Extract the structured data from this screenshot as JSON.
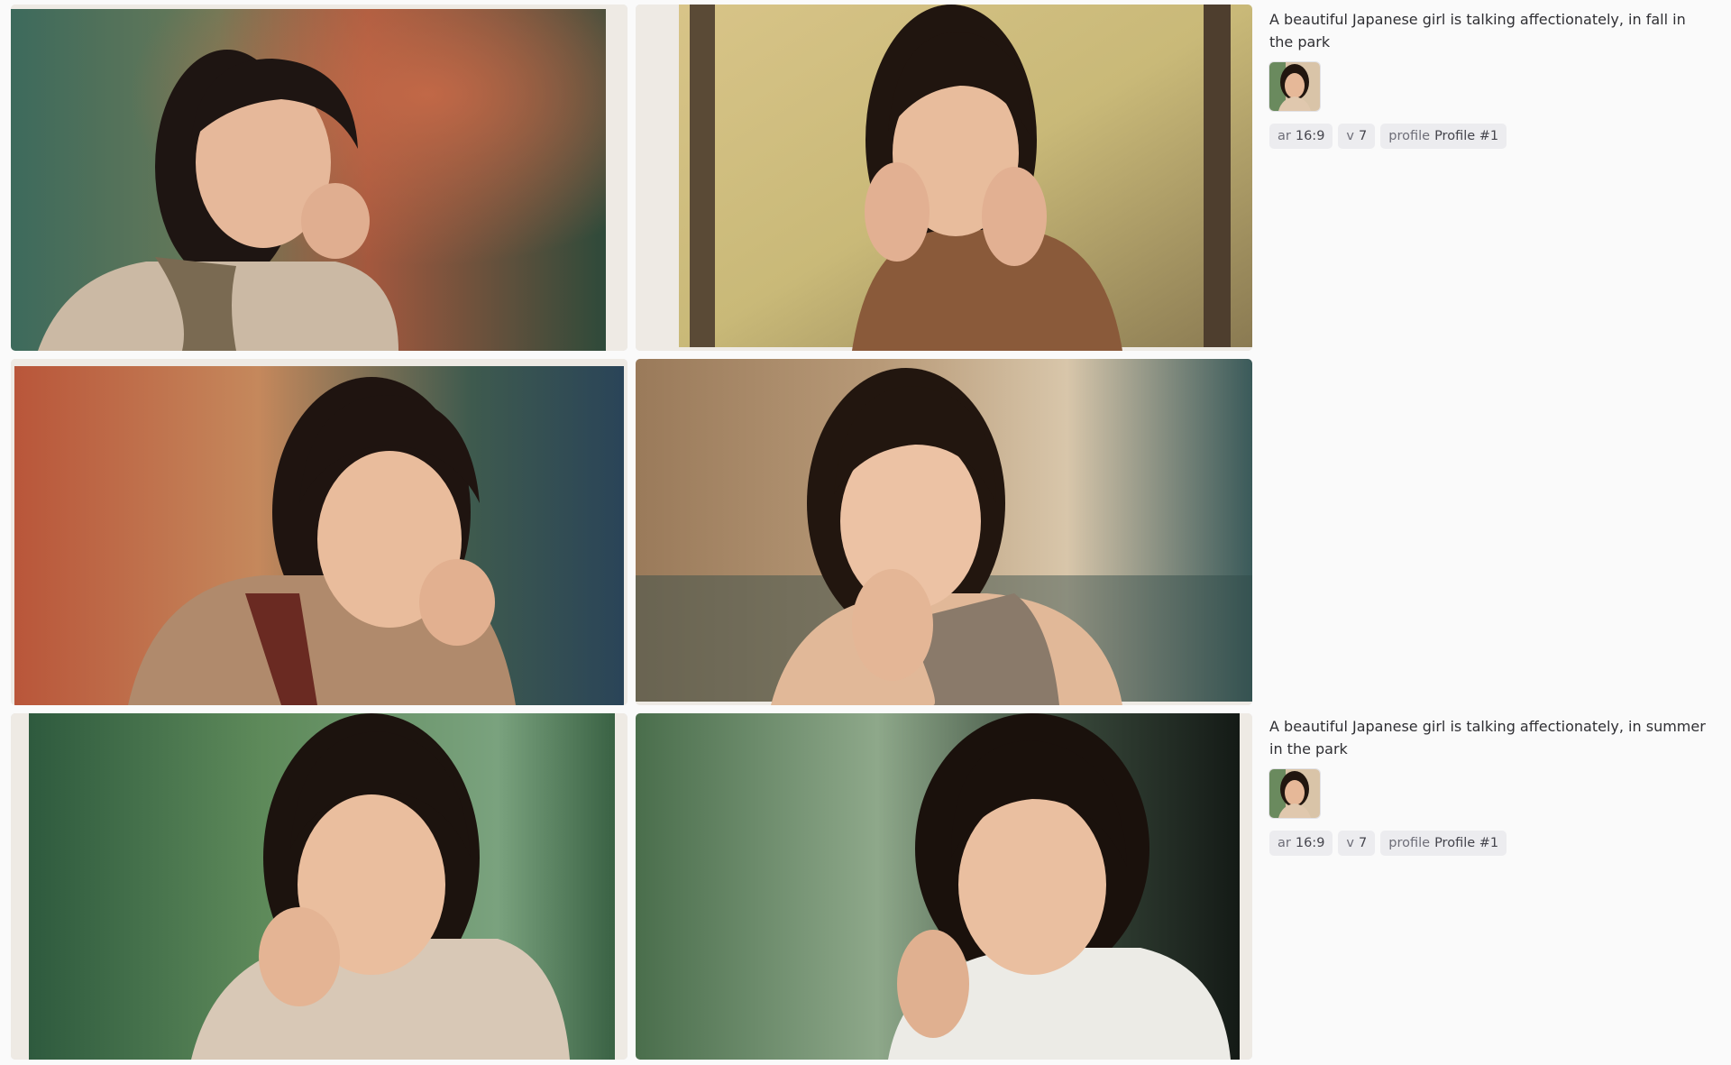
{
  "prompts": [
    {
      "text": "A beautiful Japanese girl is talking affectionately, in fall in the park",
      "params": [
        {
          "name": "ar",
          "value": "16:9"
        },
        {
          "name": "v",
          "value": "7"
        },
        {
          "name": "profile",
          "value": "Profile #1"
        }
      ]
    },
    {
      "text": "A beautiful Japanese girl is talking affectionately, in summer in the park",
      "params": [
        {
          "name": "ar",
          "value": "16:9"
        },
        {
          "name": "v",
          "value": "7"
        },
        {
          "name": "profile",
          "value": "Profile #1"
        }
      ]
    }
  ],
  "images": [
    {
      "subject": "woman-portrait",
      "setting": "autumn-park-red-foliage"
    },
    {
      "subject": "woman-portrait",
      "setting": "autumn-park-golden-foliage"
    },
    {
      "subject": "woman-portrait",
      "setting": "autumn-park-red-foliage"
    },
    {
      "subject": "woman-portrait",
      "setting": "autumn-park-soft-foliage"
    },
    {
      "subject": "woman-portrait",
      "setting": "summer-park-green-foliage"
    },
    {
      "subject": "woman-portrait",
      "setting": "summer-park-green-foliage"
    }
  ],
  "colors": {
    "background": "#fafafa",
    "text": "#2f2f33",
    "tag_bg": "#ececef",
    "tag_text": "#6e6e78"
  }
}
